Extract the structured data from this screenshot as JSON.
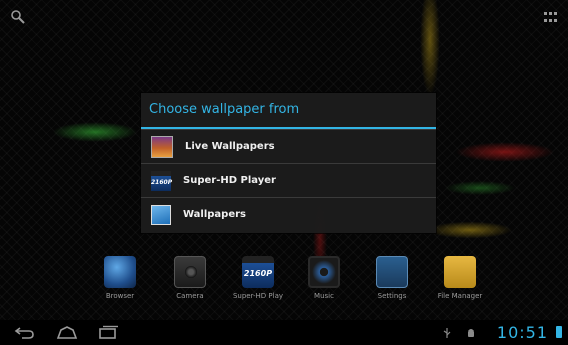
{
  "dialog": {
    "title": "Choose wallpaper from",
    "options": [
      {
        "label": "Live Wallpapers",
        "icon": "live-wallpaper-icon"
      },
      {
        "label": "Super-HD Player",
        "icon": "super-hd-player-icon",
        "badge": "2160P"
      },
      {
        "label": "Wallpapers",
        "icon": "wallpapers-icon"
      }
    ]
  },
  "dock": {
    "apps": [
      {
        "label": "Browser",
        "icon": "browser-icon"
      },
      {
        "label": "Camera",
        "icon": "camera-icon"
      },
      {
        "label": "Super-HD Play",
        "icon": "super-hd-player-icon",
        "badge": "2160P"
      },
      {
        "label": "Music",
        "icon": "music-icon"
      },
      {
        "label": "Settings",
        "icon": "settings-icon"
      },
      {
        "label": "File Manager",
        "icon": "file-manager-icon"
      }
    ]
  },
  "status": {
    "time": "10:51",
    "accent": "#33b5e5"
  }
}
